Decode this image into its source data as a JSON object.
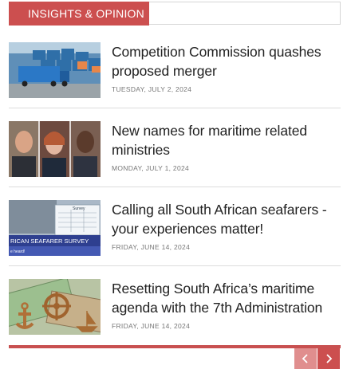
{
  "section": {
    "title": "INSIGHTS & OPINION"
  },
  "articles": [
    {
      "title": "Competition Commission quashes proposed merger",
      "date": "TUESDAY, JULY 2, 2024",
      "image": "truck-containers-photo"
    },
    {
      "title": "New names for maritime related ministries",
      "date": "MONDAY, JULY 1, 2024",
      "image": "ministers-portraits-photo"
    },
    {
      "title": "Calling all South African seafarers - your experiences matter!",
      "date": "FRIDAY, JUNE 14, 2024",
      "image": "seafarer-survey-photo",
      "image_text": "RICAN SEAFARER SURVEY",
      "image_subtext": "e heard!",
      "image_label": "Survey"
    },
    {
      "title": "Resetting South Africa’s maritime agenda with the 7th Administration",
      "date": "FRIDAY, JUNE 14, 2024",
      "image": "anchor-money-photo"
    }
  ],
  "pager": {
    "prev_icon": "chevron-left-icon",
    "next_icon": "chevron-right-icon"
  },
  "colors": {
    "accent": "#cc4f4f",
    "accent_light": "#e08e8e"
  }
}
